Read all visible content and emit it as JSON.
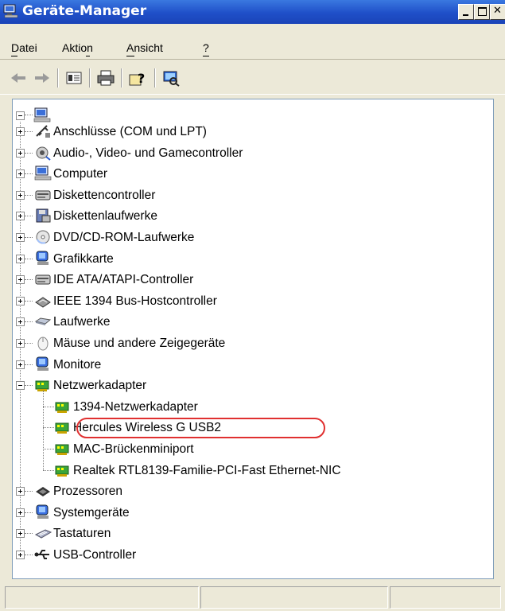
{
  "window": {
    "title": "Geräte-Manager"
  },
  "menu": [
    {
      "label": "Datei"
    },
    {
      "label": "Aktion"
    },
    {
      "label": "Ansicht"
    },
    {
      "label": "?"
    }
  ],
  "toolbar": {
    "buttons": [
      "back-arrow-icon",
      "forward-arrow-icon",
      "properties-view-icon",
      "print-icon",
      "help-icon",
      "scan-hardware-icon"
    ]
  },
  "tree": {
    "root_icon": "computer-icon",
    "categories": [
      {
        "label": "Anschlüsse (COM und LPT)",
        "icon": "port-icon"
      },
      {
        "label": "Audio-, Video- und Gamecontroller",
        "icon": "speaker-icon"
      },
      {
        "label": "Computer",
        "icon": "computer-icon"
      },
      {
        "label": "Diskettencontroller",
        "icon": "disk-controller-icon"
      },
      {
        "label": "Diskettenlaufwerke",
        "icon": "floppy-drive-icon"
      },
      {
        "label": "DVD/CD-ROM-Laufwerke",
        "icon": "cdrom-icon"
      },
      {
        "label": "Grafikkarte",
        "icon": "display-adapter-icon"
      },
      {
        "label": "IDE ATA/ATAPI-Controller",
        "icon": "ide-controller-icon"
      },
      {
        "label": "IEEE 1394 Bus-Hostcontroller",
        "icon": "firewire-icon"
      },
      {
        "label": "Laufwerke",
        "icon": "hard-drive-icon"
      },
      {
        "label": "Mäuse und andere Zeigegeräte",
        "icon": "mouse-icon"
      },
      {
        "label": "Monitore",
        "icon": "monitor-icon"
      },
      {
        "label": "Netzwerkadapter",
        "icon": "network-adapter-icon",
        "expanded": true
      },
      {
        "label": "Prozessoren",
        "icon": "processor-icon"
      },
      {
        "label": "Systemgeräte",
        "icon": "system-device-icon"
      },
      {
        "label": "Tastaturen",
        "icon": "keyboard-icon"
      },
      {
        "label": "USB-Controller",
        "icon": "usb-icon"
      }
    ],
    "network_adapters": [
      {
        "label": "1394-Netzwerkadapter"
      },
      {
        "label": "Hercules Wireless G USB2",
        "highlighted": true
      },
      {
        "label": "MAC-Brückenminiport"
      },
      {
        "label": "Realtek RTL8139-Familie-PCI-Fast Ethernet-NIC"
      }
    ]
  },
  "colors": {
    "titlebar": "#1f4fc8",
    "highlight_circle": "#e03030",
    "network_icon": "#3aa53a"
  }
}
